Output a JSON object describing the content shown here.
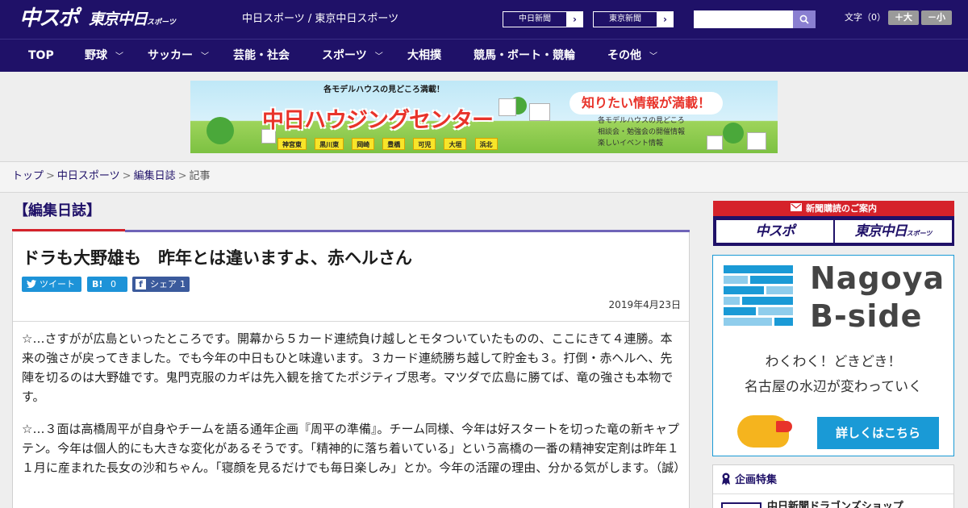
{
  "header": {
    "logo_main": "中スポ",
    "logo_sub": "東京中日",
    "logo_sub_small": "スポーツ",
    "site_name": "中日スポーツ / 東京中日スポーツ",
    "paper_links": [
      {
        "label": "中日新聞",
        "arrow": "›"
      },
      {
        "label": "東京新聞",
        "arrow": "›"
      }
    ],
    "search_placeholder": "",
    "fontsize": {
      "label": "文字（0）",
      "larger": "＋大",
      "smaller": "－小"
    }
  },
  "nav": {
    "items": [
      {
        "label": "TOP",
        "dropdown": ""
      },
      {
        "label": "野球",
        "dropdown": "﹀"
      },
      {
        "label": "サッカー",
        "dropdown": "﹀"
      },
      {
        "label": "芸能・社会",
        "dropdown": ""
      },
      {
        "label": "スポーツ",
        "dropdown": "﹀"
      },
      {
        "label": "大相撲",
        "dropdown": ""
      },
      {
        "label": "競馬・ボート・競輪",
        "dropdown": ""
      },
      {
        "label": "その他",
        "dropdown": "﹀"
      }
    ]
  },
  "ad_banner": {
    "top_text": "各モデルハウスの見どころ満載！",
    "title": "中日ハウジングセンター",
    "tagline": "知りたい情報が満載！",
    "bullets": [
      "各モデルハウスの見どころ",
      "相談会・勉強会の開催情報",
      "楽しいイベント情報"
    ],
    "cities": [
      "神宮東",
      "黒川東",
      "岡崎",
      "豊橋",
      "可児",
      "大垣",
      "浜北"
    ]
  },
  "breadcrumb": {
    "items": [
      {
        "label": "トップ",
        "link": true
      },
      {
        "label": "中日スポーツ",
        "link": true
      },
      {
        "label": "編集日誌",
        "link": true
      },
      {
        "label": "記事",
        "link": false
      }
    ],
    "separator": ">"
  },
  "section": {
    "title": "【編集日誌】"
  },
  "article": {
    "title": "ドラも大野雄も　昨年とは違いますよ、赤ヘルさん",
    "share": {
      "tweet_label": "ツイート",
      "hatena_label": "0",
      "facebook_label": "シェア",
      "facebook_count": "1"
    },
    "date": "2019年4月23日",
    "paragraphs": [
      "☆…さすがが広島といったところです。開幕から５カード連続負け越しとモタついていたものの、ここにきて４連勝。本来の強さが戻ってきました。でも今年の中日もひと味違います。３カード連続勝ち越して貯金も３。打倒・赤ヘルへ、先陣を切るのは大野雄です。鬼門克服のカギは先入観を捨てたポジティブ思考。マツダで広島に勝てば、竜の強さも本物です。",
      "☆…３面は高橋周平が自身やチームを語る通年企画『周平の準備』。チーム同様、今年は好スタートを切った竜の新キャプテン。今年は個人的にも大きな変化があるそうです。「精神的に落ち着いている」という高橋の一番の精神安定剤は昨年１１月に産まれた長女の沙和ちゃん。「寝顔を見るだけでも毎日楽しみ」とか。今年の活躍の理由、分かる気がします。（誠）"
    ]
  },
  "sidebar": {
    "subscription": {
      "heading": "新聞購読のご案内",
      "logo_left": "中スポ",
      "logo_right": "東京中日",
      "logo_right_small": "スポーツ"
    },
    "nagoya": {
      "title_line1": "Nagoya",
      "title_line2": "B-side",
      "copy1": "わくわく！どきどき！",
      "copy2": "名古屋の水辺が変わっていく",
      "button": "詳しくはこちら"
    },
    "feature": {
      "title": "企画特集",
      "item": "中日新聞ドラゴンズショップ"
    }
  }
}
